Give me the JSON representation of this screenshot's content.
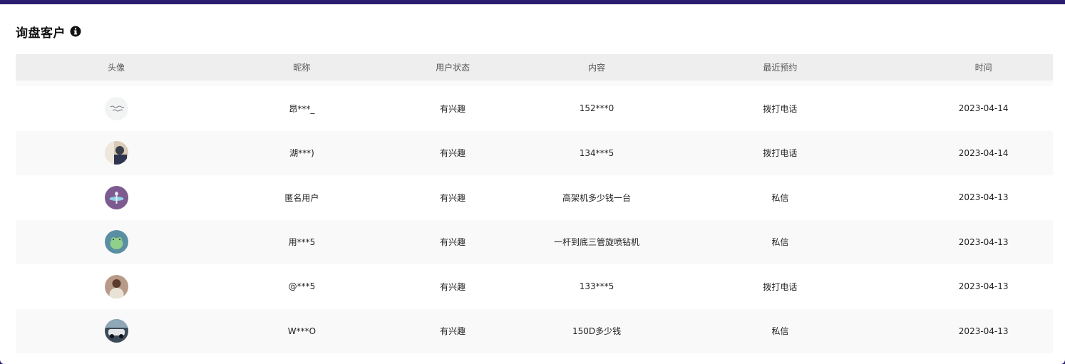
{
  "panel": {
    "title": "询盘客户",
    "info_icon": "info-circle-icon"
  },
  "table": {
    "headers": [
      "头像",
      "昵称",
      "用户状态",
      "内容",
      "最近预约",
      "时间"
    ],
    "rows": [
      {
        "avatar": "avatar-handwriting",
        "nickname": "昂***_",
        "status": "有兴趣",
        "content": "152***0",
        "recent": "拨打电话",
        "time": "2023-04-14"
      },
      {
        "avatar": "avatar-man-photo",
        "nickname": "湖***)",
        "status": "有兴趣",
        "content": "134***5",
        "recent": "拨打电话",
        "time": "2023-04-14"
      },
      {
        "avatar": "avatar-purple-cartoon",
        "nickname": "匿名用户",
        "status": "有兴趣",
        "content": "高架机多少钱一台",
        "recent": "私信",
        "time": "2023-04-13"
      },
      {
        "avatar": "avatar-frog-cartoon",
        "nickname": "用***5",
        "status": "有兴趣",
        "content": "一杆到底三管旋喷钻机",
        "recent": "私信",
        "time": "2023-04-13"
      },
      {
        "avatar": "avatar-woman-photo",
        "nickname": "@***5",
        "status": "有兴趣",
        "content": "133***5",
        "recent": "拨打电话",
        "time": "2023-04-13"
      },
      {
        "avatar": "avatar-car-photo",
        "nickname": "W***O",
        "status": "有兴趣",
        "content": "150D多少钱",
        "recent": "私信",
        "time": "2023-04-13"
      }
    ]
  },
  "colors": {
    "top_border": "#2a1d6e",
    "header_bg": "#eeeeee",
    "alt_row_bg": "#f9f9f9"
  }
}
